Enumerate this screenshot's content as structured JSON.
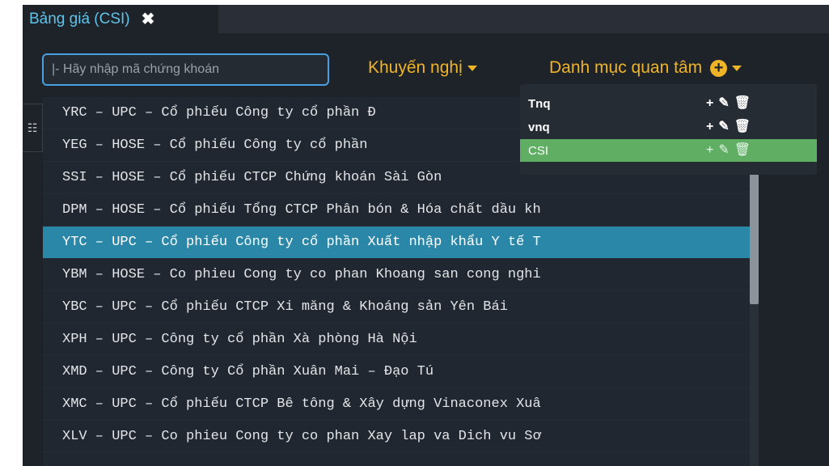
{
  "tab": {
    "title": "Bảng giá (CSI)",
    "close_icon": "close-icon"
  },
  "search": {
    "placeholder": "|- Hãy nhập mã chứng khoán"
  },
  "menus": {
    "recommend": "Khuyến nghị",
    "watchlist": "Danh mục quan tâm",
    "add_icon": "plus-circle-icon"
  },
  "suggestions": [
    {
      "text": "YRC – UPC – Cổ phiếu Công ty cổ phần Đ"
    },
    {
      "text": "YEG – HOSE – Cổ phiếu Công ty cổ phần"
    },
    {
      "text": "SSI – HOSE – Cổ phiếu CTCP Chứng khoán Sài Gòn"
    },
    {
      "text": "DPM – HOSE – Cổ phiếu Tổng CTCP Phân bón & Hóa chất dầu kh"
    },
    {
      "text": "YTC – UPC – Cổ phiếu Công ty cổ phần Xuất nhập khẩu Y tế T",
      "selected": true
    },
    {
      "text": "YBM – HOSE – Co phieu Cong ty co phan Khoang san cong nghi"
    },
    {
      "text": "YBC – UPC – Cổ phiếu CTCP Xi măng & Khoáng sản Yên Bái"
    },
    {
      "text": "XPH – UPC – Công ty cổ phần Xà phòng Hà Nội"
    },
    {
      "text": "XMD – UPC – Công ty Cổ phần Xuân Mai – Đạo Tú"
    },
    {
      "text": "XMC – UPC – Cổ phiếu CTCP Bê tông & Xây dựng Vinaconex Xuâ"
    },
    {
      "text": "XLV – UPC – Co phieu Cong ty co phan Xay lap va Dich vu Sơ"
    }
  ],
  "watchlists": [
    {
      "name": "Tnq"
    },
    {
      "name": "vnq"
    },
    {
      "name": "CSI",
      "active": true
    }
  ],
  "watchlist_action_icons": {
    "add": "+",
    "edit": "✎",
    "delete": "🗑"
  },
  "colors": {
    "accent_blue": "#5fc3ea",
    "menu_orange": "#f0b429",
    "selected_row": "#2b87a8",
    "active_watchlist": "#5fae64"
  }
}
